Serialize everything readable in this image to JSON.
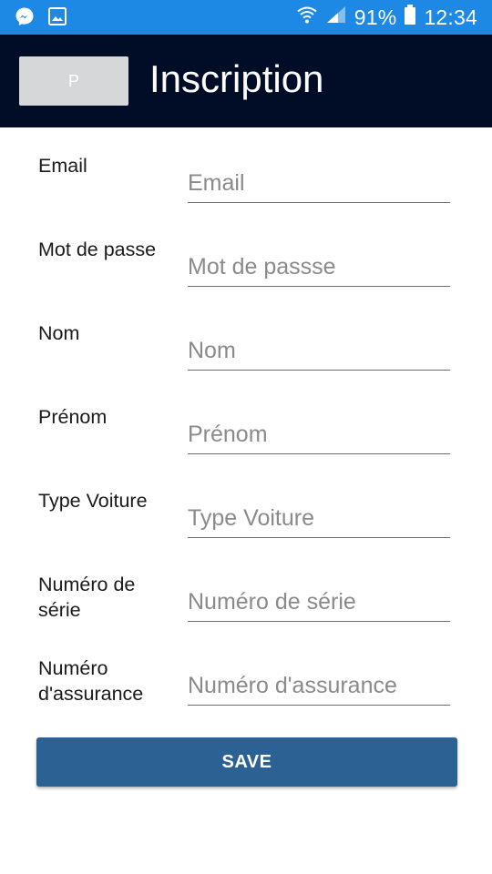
{
  "status_bar": {
    "left_icons": [
      "messenger-icon",
      "image-icon"
    ],
    "right_icons": [
      "wifi-icon",
      "signal-icon",
      "battery-icon"
    ],
    "battery": "91%",
    "time": "12:34",
    "color": "#1e88e5"
  },
  "app_bar": {
    "logo_text": "P",
    "title": "Inscription",
    "color": "#010c26"
  },
  "form": {
    "fields": [
      {
        "label": "Email",
        "placeholder": "Email",
        "value": ""
      },
      {
        "label": "Mot de passe",
        "placeholder": "Mot de passse",
        "value": ""
      },
      {
        "label": "Nom",
        "placeholder": "Nom",
        "value": ""
      },
      {
        "label": "Prénom",
        "placeholder": "Prénom",
        "value": ""
      },
      {
        "label": "Type Voiture",
        "placeholder": "Type Voiture",
        "value": ""
      },
      {
        "label": "Numéro de série",
        "placeholder": "Numéro de série",
        "value": ""
      },
      {
        "label": "Numéro d'assurance",
        "placeholder": "Numéro d'assurance",
        "value": ""
      }
    ],
    "save_label": "SAVE",
    "save_color": "#2c6193"
  }
}
